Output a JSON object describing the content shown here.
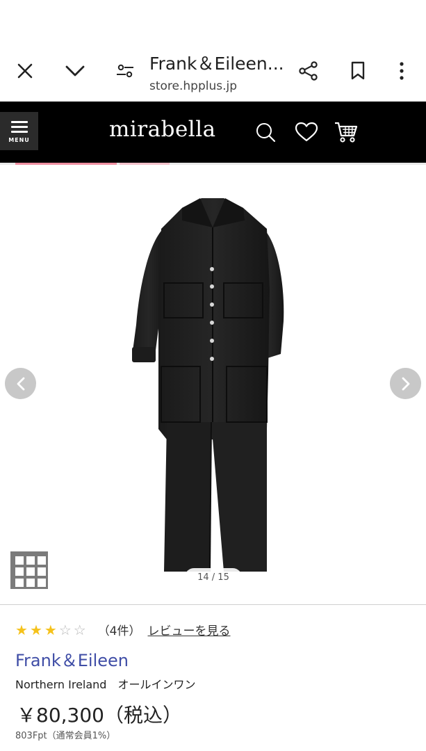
{
  "browser": {
    "tab_title": "Frank＆Eileen...",
    "url": "store.hpplus.jp"
  },
  "header": {
    "menu_label": "MENU",
    "logo": "mirabella"
  },
  "gallery": {
    "counter": "14 / 15",
    "current_image": 14,
    "total_images": 15
  },
  "product": {
    "rating": 3,
    "rating_max": 5,
    "review_count": "（4件）",
    "review_link": "レビューを見る",
    "brand": "Frank＆Eileen",
    "name": "Northern Ireland　オールインワン",
    "price": "￥80,300（税込）",
    "points": "803Fpt（通常会員1%）"
  },
  "colors": {
    "brand_link": "#3f4da6",
    "star_on": "#f5c21b",
    "accent": "#ef8fa1"
  }
}
